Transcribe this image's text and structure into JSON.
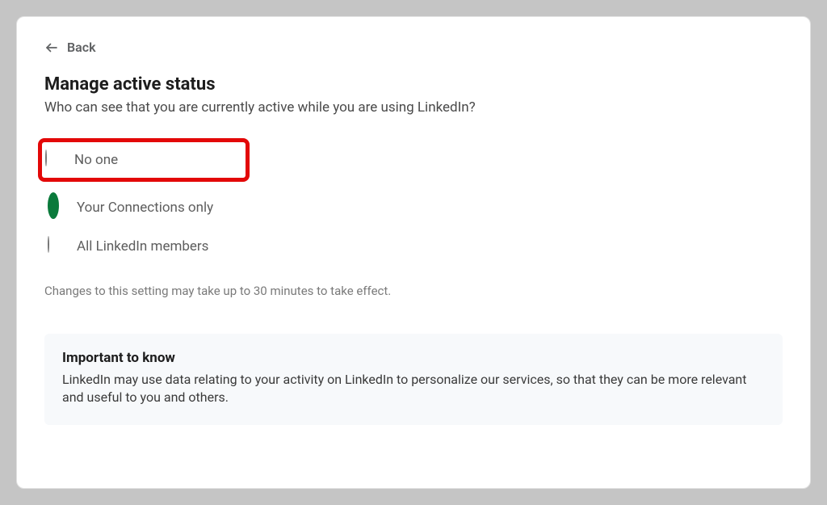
{
  "nav": {
    "back_label": "Back"
  },
  "header": {
    "title": "Manage active status",
    "subtitle": "Who can see that you are currently active while you are using LinkedIn?"
  },
  "options": [
    {
      "id": "no-one",
      "label": "No one",
      "selected": false,
      "highlighted": true
    },
    {
      "id": "connections",
      "label": "Your Connections only",
      "selected": true,
      "highlighted": false
    },
    {
      "id": "all",
      "label": "All LinkedIn members",
      "selected": false,
      "highlighted": false
    }
  ],
  "note": "Changes to this setting may take up to 30 minutes to take effect.",
  "info": {
    "title": "Important to know",
    "text": "LinkedIn may use data relating to your activity on LinkedIn to personalize our services, so that they can be more relevant and useful to you and others."
  }
}
